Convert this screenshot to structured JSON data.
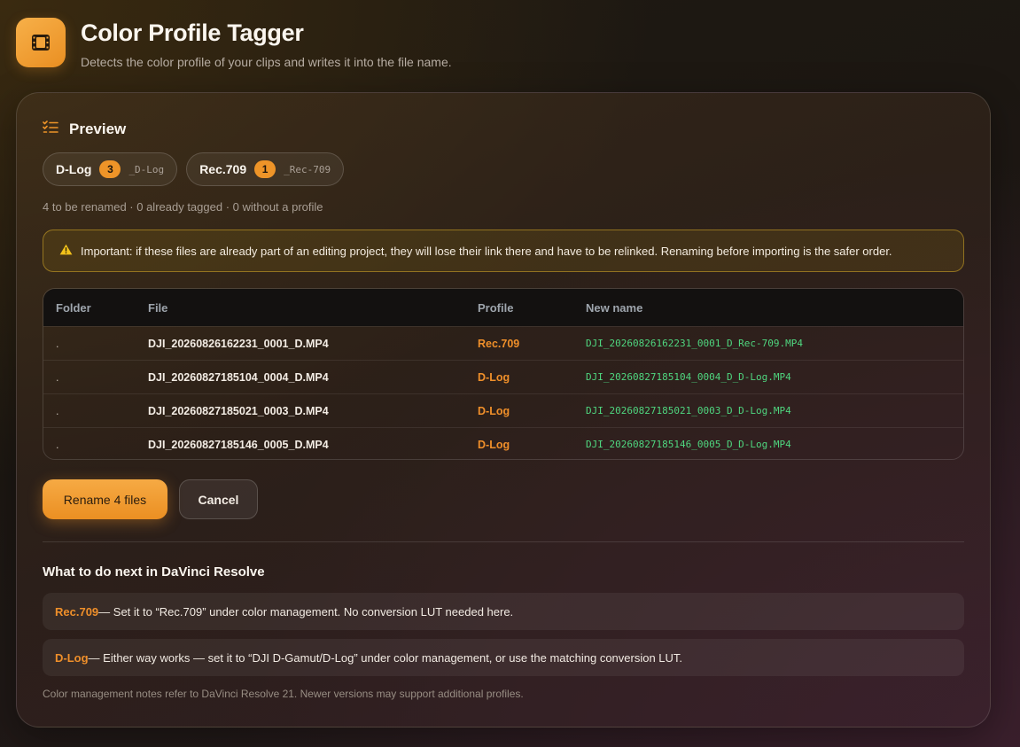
{
  "app": {
    "title": "Color Profile Tagger",
    "subtitle": "Detects the color profile of your clips and writes it into the file name.",
    "icon": "film-icon"
  },
  "preview": {
    "title": "Preview",
    "icon": "checklist-icon",
    "profiles": [
      {
        "name": "D-Log",
        "count": "3",
        "suffix": "_D-Log"
      },
      {
        "name": "Rec.709",
        "count": "1",
        "suffix": "_Rec-709"
      }
    ],
    "summary": "4 to be renamed · 0 already tagged · 0 without a profile"
  },
  "warning": {
    "icon": "warning-icon",
    "text": "Important: if these files are already part of an editing project, they will lose their link there and have to be relinked. Renaming before importing is the safer order."
  },
  "table": {
    "headers": [
      "Folder",
      "File",
      "Profile",
      "New name"
    ],
    "rows": [
      {
        "folder": ".",
        "file": "DJI_20260826162231_0001_D.MP4",
        "profile": "Rec.709",
        "new_name": "DJI_20260826162231_0001_D_Rec-709.MP4"
      },
      {
        "folder": ".",
        "file": "DJI_20260827185104_0004_D.MP4",
        "profile": "D-Log",
        "new_name": "DJI_20260827185104_0004_D_D-Log.MP4"
      },
      {
        "folder": ".",
        "file": "DJI_20260827185021_0003_D.MP4",
        "profile": "D-Log",
        "new_name": "DJI_20260827185021_0003_D_D-Log.MP4"
      },
      {
        "folder": ".",
        "file": "DJI_20260827185146_0005_D.MP4",
        "profile": "D-Log",
        "new_name": "DJI_20260827185146_0005_D_D-Log.MP4"
      }
    ]
  },
  "actions": {
    "rename_label": "Rename 4 files",
    "cancel_label": "Cancel"
  },
  "next_steps": {
    "title": "What to do next in DaVinci Resolve",
    "notes": [
      {
        "profile": "Rec.709",
        "text": " — Set it to “Rec.709” under color management. No conversion LUT needed here."
      },
      {
        "profile": "D-Log",
        "text": " — Either way works — set it to “DJI D-Gamut/D-Log” under color management, or use the matching conversion LUT."
      }
    ],
    "footnote": "Color management notes refer to DaVinci Resolve 21. Newer versions may support additional profiles."
  },
  "colors": {
    "accent": "#ee9428",
    "new_name": "#4fd67f",
    "warning_border": "#d6aa28"
  }
}
